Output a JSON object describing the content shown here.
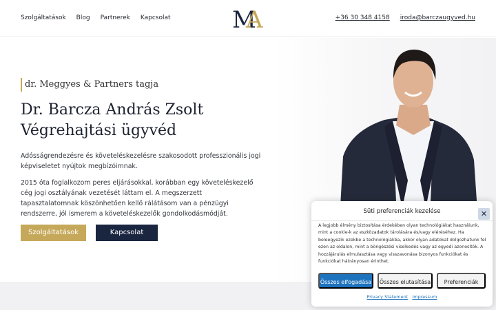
{
  "nav": {
    "items": [
      {
        "label": "Szolgáltatások"
      },
      {
        "label": "Blog"
      },
      {
        "label": "Partnerek"
      },
      {
        "label": "Kapcsolat"
      }
    ]
  },
  "logo": {
    "text": "MA"
  },
  "header_contact": {
    "phone": "+36 30 348 4158",
    "email": "iroda@barczaugyved.hu"
  },
  "hero": {
    "tagline": "dr. Meggyes & Partners tagja",
    "title_line1": "Dr. Barcza András Zsolt",
    "title_line2": "Végrehajtási ügyvéd",
    "paragraph1": "Adósságrendezésre és követeléskezelésre szakosodott professzionális jogi képviseletet nyújtok megbízóimnak.",
    "paragraph2": "2015 óta foglalkozom peres eljárásokkal, korábban egy követeléskezelő cég jogi osztályának vezetését láttam el. A megszerzett tapasztalatomnak köszönhetően kellő rálátásom van a pénzügyi rendszerre, jól ismerem a követeléskezelők gondolkodásmódját.",
    "btn_services": "Szolgáltatások",
    "btn_contact": "Kapcsolat"
  },
  "cookie": {
    "title": "Süti preferenciák kezelése",
    "close_glyph": "✕",
    "text": "A legjobb élmény biztosítása érdekében olyan technológiákat használunk, mint a cookie-k az eszközadatok tárolására és/vagy eléréséhez. Ha beleegyezik ezekbe a technológiákba, akkor olyan adatokat dolgozhatunk fel ezen az oldalon, mint a böngészési viselkedés vagy az egyedi azonosítók. A hozzájárulás elmulasztása vagy visszavonása bizonyos funkciókat és funkciókat hátrányosan érinthet.",
    "accept": "Összes elfogadása",
    "deny": "Összes elutasítása",
    "preferences": "Preferenciák",
    "privacy": "Privacy Statement",
    "impressum": "Impressum"
  },
  "colors": {
    "gold": "#c6a85a",
    "navy": "#1a2540",
    "cookie_blue": "#1e73be"
  }
}
